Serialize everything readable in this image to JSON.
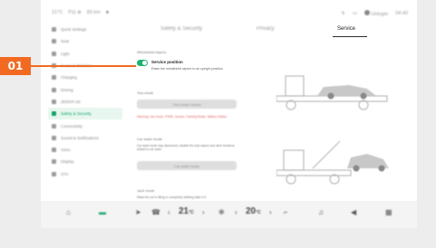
{
  "statusbar": {
    "left": [
      "21°C",
      "P⊡ ⊕",
      "83 km",
      "■"
    ],
    "right": [
      "↯",
      "▭",
      "Unlogin",
      "04:40"
    ]
  },
  "sidebar": {
    "items": [
      {
        "label": "Quick Settings",
        "active": false
      },
      {
        "label": "Seat",
        "active": false
      },
      {
        "label": "Light",
        "active": false
      },
      {
        "label": "Doors & Windows",
        "active": false
      },
      {
        "label": "Charging",
        "active": false
      },
      {
        "label": "Driving",
        "active": false
      },
      {
        "label": "ZEEKR AD",
        "active": false
      },
      {
        "label": "Safety & Security",
        "active": true
      },
      {
        "label": "Connectivity",
        "active": false
      },
      {
        "label": "Sound & Notifications",
        "active": false
      },
      {
        "label": "Voice",
        "active": false
      },
      {
        "label": "Display",
        "active": false
      },
      {
        "label": "OTA",
        "active": false
      }
    ]
  },
  "tabs": [
    {
      "label": "Safety & Security"
    },
    {
      "label": "Privacy"
    },
    {
      "label": "Service"
    }
  ],
  "content": {
    "section1_title": "Windshield wipers",
    "option_label": "Service position",
    "option_desc": "Raise the windshield wipers to an upright position",
    "section2_title": "Tow mode",
    "tow_button": "Tow mode cancel",
    "tow_warning": "Warning: tow mode, P/N/R, service, Parking Brake, Battery Status",
    "section3_title": "Car wash mode",
    "carwash_desc": "Car wash mode may disconnect, disable the auto wipers and other functions related to car wash.",
    "carwash_button": "Car wash mode",
    "section4_title": "Jack mode",
    "jack_desc": "Raise the car to lifting or completely stabling state in it."
  },
  "callout": {
    "label": "01"
  },
  "bottombar": {
    "temp_left": "21",
    "temp_left_unit": "°C",
    "temp_right": "20",
    "temp_right_unit": "°C"
  },
  "colors": {
    "accent": "#16a56b",
    "callout": "#f26a21"
  }
}
